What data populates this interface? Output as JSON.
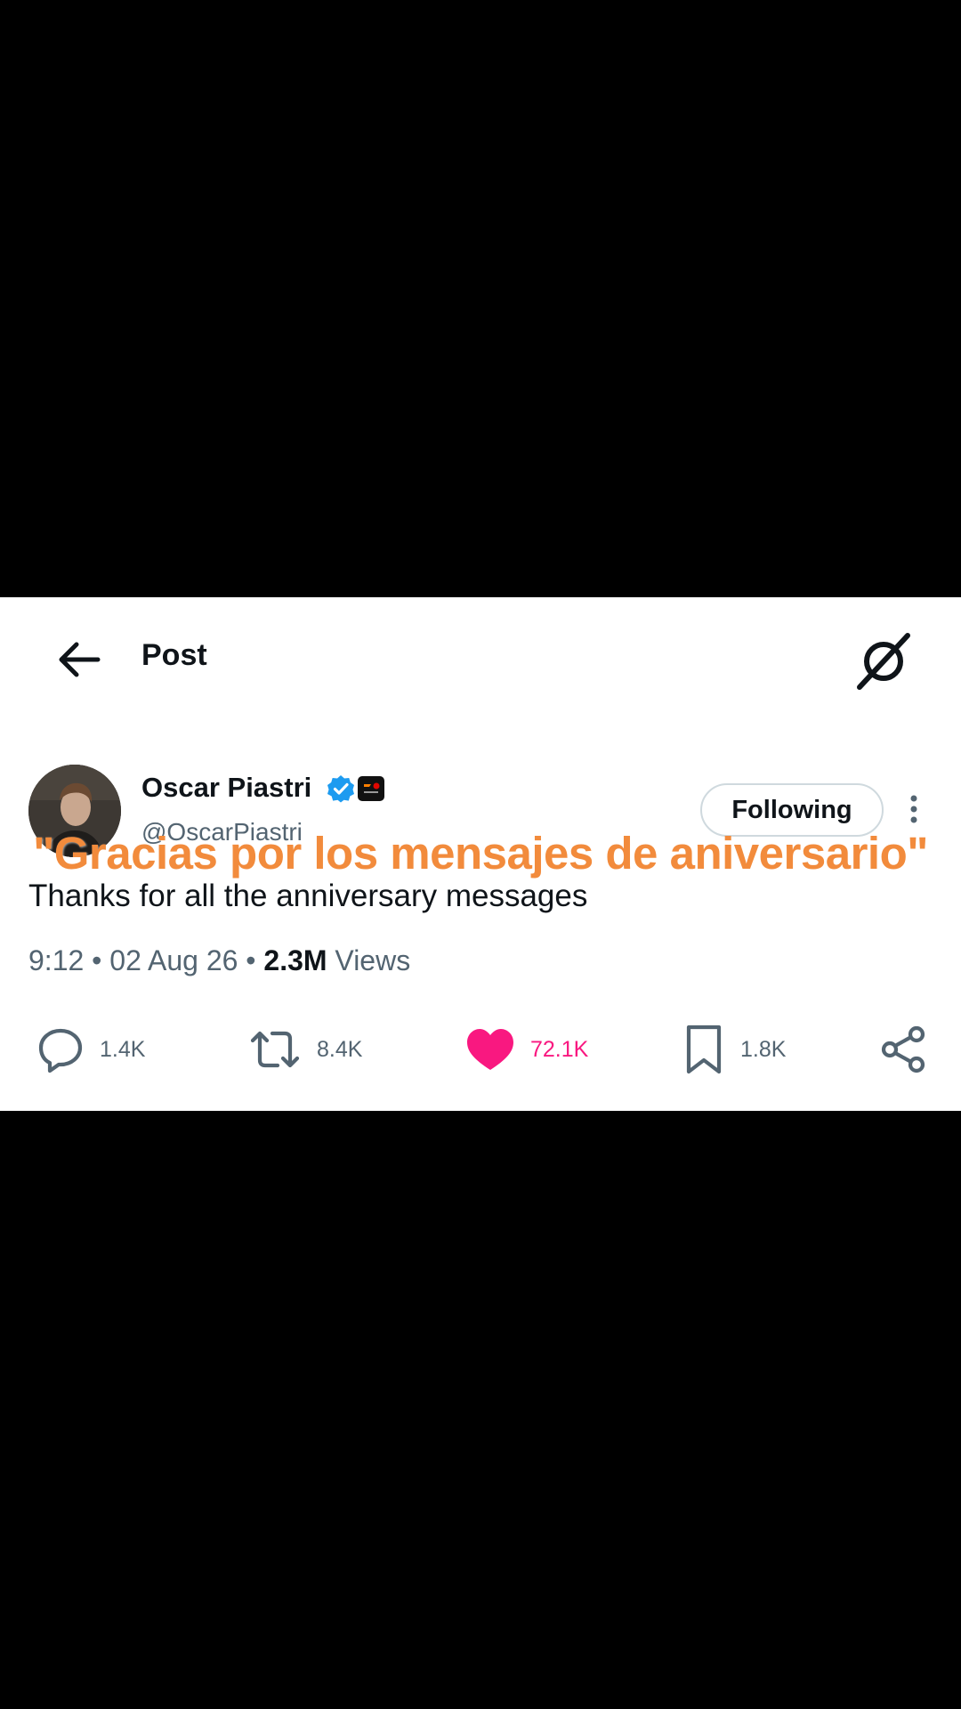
{
  "header": {
    "title": "Post"
  },
  "author": {
    "name": "Oscar Piastri",
    "handle": "@OscarPiastri"
  },
  "follow_button": {
    "label": "Following"
  },
  "caption": "\"Gracias por los mensajes de aniversario\"",
  "post": {
    "text": "Thanks for all the anniversary messages",
    "time": "9:12",
    "separator1": " • ",
    "date": "02 Aug 26",
    "separator2": " • ",
    "views_count": "2.3M",
    "views_label": " Views"
  },
  "actions": {
    "replies": "1.4K",
    "reposts": "8.4K",
    "likes": "72.1K",
    "bookmarks": "1.8K"
  },
  "colors": {
    "accent_blue": "#1d9bf0",
    "like_pink": "#f91880",
    "caption_orange": "#f28b3c",
    "text_primary": "#0f1419",
    "text_secondary": "#536471"
  },
  "icons": [
    "back-arrow-icon",
    "grok-icon",
    "verified-badge-icon",
    "affiliate-badge-icon",
    "more-options-icon",
    "reply-icon",
    "repost-icon",
    "like-icon",
    "bookmark-icon",
    "share-icon"
  ]
}
